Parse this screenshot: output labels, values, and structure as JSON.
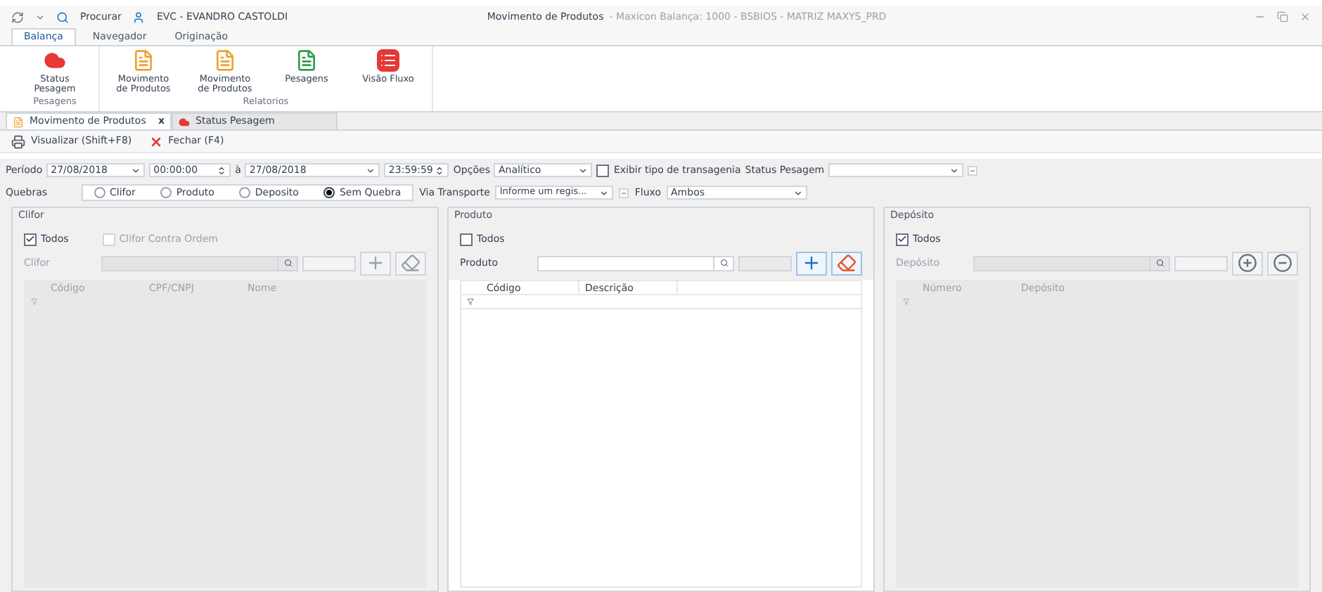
{
  "title_bar": {
    "search_label": "Procurar",
    "user": "EVC - EVANDRO CASTOLDI",
    "title": "Movimento de Produtos",
    "subtitle": "- Maxicon Balança: 1000 - BSBIOS - MATRIZ MAXYS_PRD"
  },
  "ribbon_tabs": [
    {
      "label": "Balança",
      "selected": true
    },
    {
      "label": "Navegador",
      "selected": false
    },
    {
      "label": "Originação",
      "selected": false
    }
  ],
  "ribbon_groups": [
    {
      "label": "Pesagens",
      "buttons": [
        {
          "label": "Status Pesagem",
          "kind": "cloud"
        }
      ]
    },
    {
      "label": "Relatorios",
      "buttons": [
        {
          "label": "Movimento de Produtos",
          "kind": "document"
        },
        {
          "label": "Movimento de Produtos",
          "kind": "document"
        },
        {
          "label": "Pesagens",
          "kind": "green"
        },
        {
          "label": "Visão Fluxo",
          "kind": "list"
        }
      ]
    }
  ],
  "doc_tabs": [
    {
      "label": "Movimento de Produtos",
      "selected": true,
      "kind": "document",
      "close": "x"
    },
    {
      "label": "Status Pesagem",
      "selected": false,
      "kind": "cloud"
    }
  ],
  "toolbar": [
    {
      "label": "Visualizar (Shift+F8)",
      "kind": "print"
    },
    {
      "label": "Fechar (F4)",
      "kind": "close"
    }
  ],
  "period": {
    "label": "Período",
    "date_from": "27/08/2018",
    "time_from": "00:00:00",
    "separator": "à",
    "date_to": "27/08/2018",
    "time_to": "23:59:59",
    "options_label": "Opções",
    "options_value": "Analítico",
    "transgenic": {
      "label": "Exibir tipo de transagenia",
      "checked": false
    },
    "status_label": "Status Pesagem"
  },
  "breaks": {
    "label": "Quebras",
    "options": [
      {
        "label": "Clifor",
        "selected": false
      },
      {
        "label": "Produto",
        "selected": false
      },
      {
        "label": "Deposito",
        "selected": false
      },
      {
        "label": "Sem Quebra",
        "selected": true
      }
    ],
    "transport_label": "Via Transporte",
    "transport_placeholder": "Informe um regis...",
    "flow_label": "Fluxo",
    "flow_value": "Ambos"
  },
  "panels": [
    {
      "title": "Clifor",
      "disabled": true,
      "checks": [
        {
          "label": "Todos",
          "checked": true,
          "disabled": false
        },
        {
          "label": "Clifor Contra Ordem",
          "checked": false,
          "disabled": true
        }
      ],
      "field_label": "Clifor",
      "buttons": [
        {
          "kind": "plus"
        },
        {
          "kind": "eraser"
        }
      ],
      "columns": [
        "Código",
        "CPF/CNPJ",
        "Nome"
      ]
    },
    {
      "title": "Produto",
      "disabled": false,
      "checks": [
        {
          "label": "Todos",
          "checked": false,
          "disabled": false
        }
      ],
      "field_label": "Produto",
      "buttons": [
        {
          "kind": "plus"
        },
        {
          "kind": "eraser"
        }
      ],
      "columns": [
        "Código",
        "Descrição"
      ]
    },
    {
      "title": "Depósito",
      "disabled": true,
      "checks": [
        {
          "label": "Todos",
          "checked": true,
          "disabled": false
        }
      ],
      "field_label": "Depósito",
      "buttons": [
        {
          "kind": "plus-circle"
        },
        {
          "kind": "minus-circle"
        }
      ],
      "columns": [
        "Número",
        "Depósito"
      ]
    }
  ]
}
